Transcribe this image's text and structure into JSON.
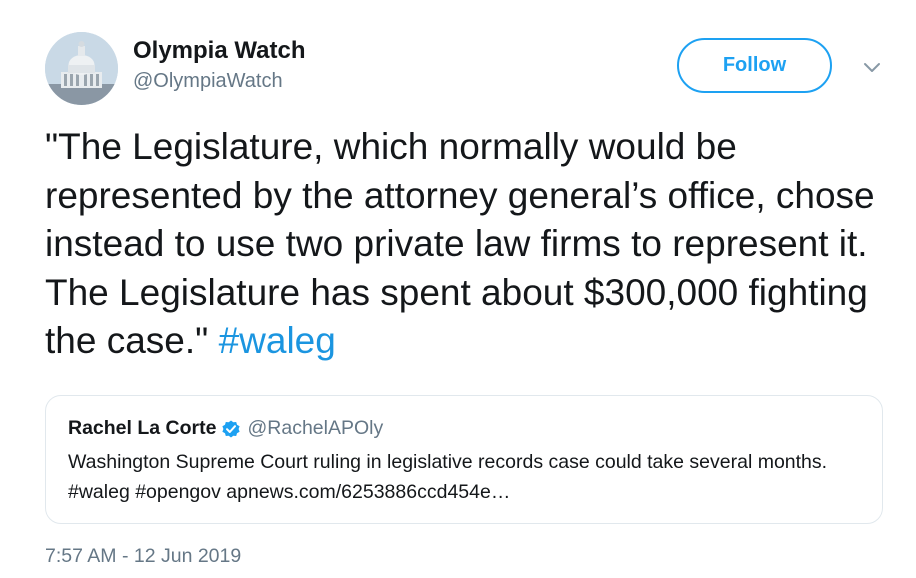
{
  "author": {
    "name": "Olympia Watch",
    "handle": "@OlympiaWatch",
    "avatar_icon": "capitol-dome-avatar"
  },
  "follow_button": {
    "label": "Follow"
  },
  "more_menu": {
    "icon": "chevron-down-icon"
  },
  "tweet": {
    "text": "\"The Legislature, which normally would be represented by the attorney general’s office, chose instead to use two private law firms to represent it. The Legislature has spent about $300,000 fighting the case.\"",
    "hashtag": "#waleg"
  },
  "quoted_tweet": {
    "author_name": "Rachel La Corte",
    "verified_icon": "verified-badge-icon",
    "handle": "@RachelAPOly",
    "text": "Washington Supreme Court ruling in legislative records case could take several months. #waleg #opengov apnews.com/6253886ccd454e…"
  },
  "timestamp": "7:57 AM - 12 Jun 2019",
  "colors": {
    "accent": "#1da1f2",
    "hashtag": "#1b95e0",
    "secondary_text": "#657786",
    "border": "#e1e8ed"
  }
}
